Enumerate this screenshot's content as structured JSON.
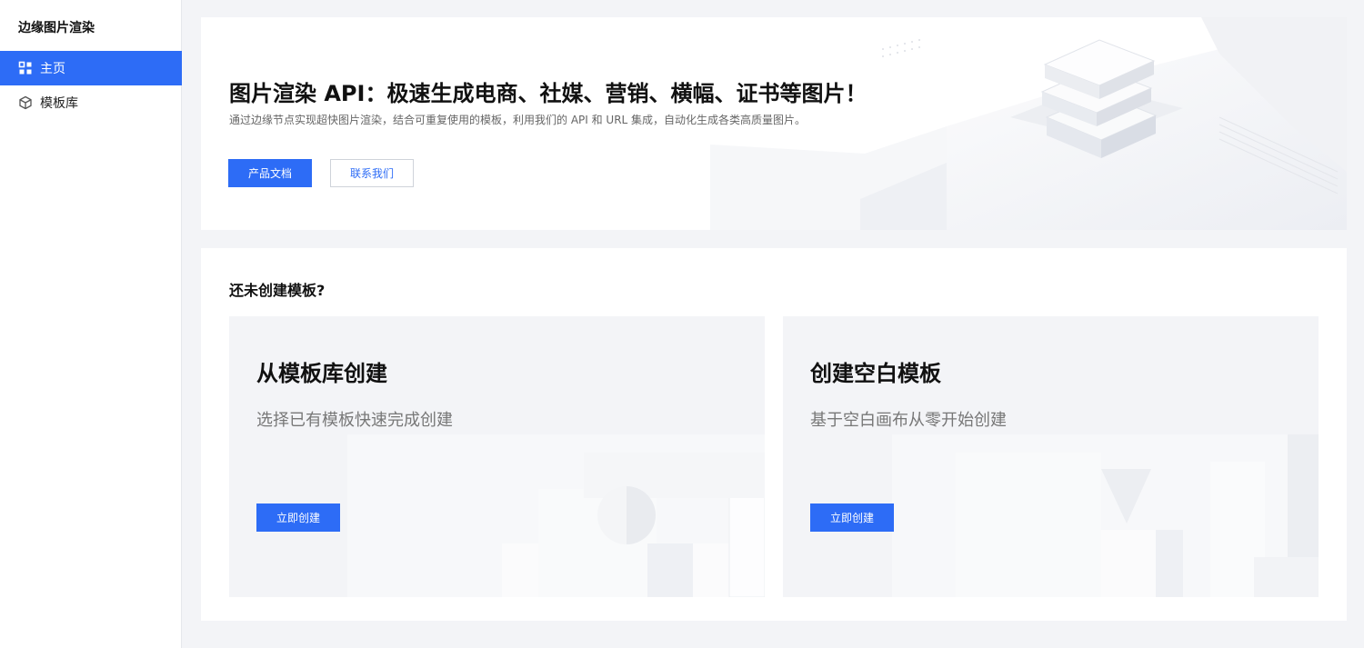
{
  "app": {
    "title": "边缘图片渲染"
  },
  "sidebar": {
    "items": [
      {
        "label": "主页",
        "icon": "grid-icon",
        "active": true
      },
      {
        "label": "模板库",
        "icon": "cube-icon",
        "active": false
      }
    ]
  },
  "hero": {
    "title": "图片渲染 API：极速生成电商、社媒、营销、横幅、证书等图片！",
    "subtitle": "通过边缘节点实现超快图片渲染，结合可重复使用的模板，利用我们的 API 和 URL 集成，自动化生成各类高质量图片。",
    "docs_button": "产品文档",
    "contact_button": "联系我们"
  },
  "create": {
    "heading": "还未创建模板?",
    "cards": [
      {
        "title": "从模板库创建",
        "description": "选择已有模板快速完成创建",
        "button": "立即创建"
      },
      {
        "title": "创建空白模板",
        "description": "基于空白画布从零开始创建",
        "button": "立即创建"
      }
    ]
  },
  "colors": {
    "accent": "#2d6cf6",
    "background": "#f3f4f7",
    "card": "#ffffff"
  }
}
